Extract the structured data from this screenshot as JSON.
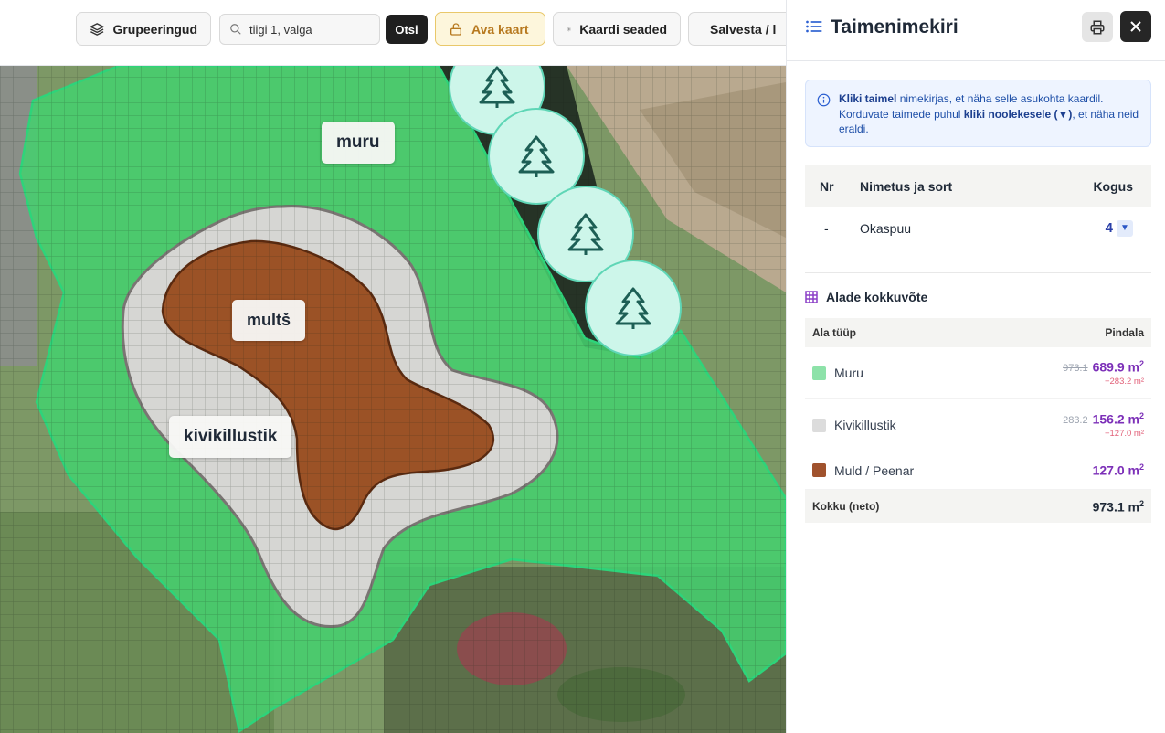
{
  "toolbar": {
    "groupings_label": "Grupeeringud",
    "search_value": "tiigi 1, valga",
    "search_button": "Otsi",
    "open_map_label": "Ava kaart",
    "map_settings_label": "Kaardi seaded",
    "save_label": "Salvesta / l"
  },
  "map": {
    "labels": {
      "lawn": "muru",
      "mulch": "multš",
      "gravel": "kivikillustik"
    },
    "tree_count": 4
  },
  "panel": {
    "title": "Taimenimekiri",
    "info": {
      "bold1": "Kliki taimel",
      "text1": " nimekirjas, et näha selle asukohta kaardil. Korduvate taimede puhul ",
      "bold2": "kliki noolekesele (▼)",
      "text2": ", et näha neid eraldi."
    },
    "plant_table": {
      "headers": {
        "nr": "Nr",
        "name": "Nimetus ja sort",
        "qty": "Kogus"
      },
      "rows": [
        {
          "nr": "-",
          "name": "Okaspuu",
          "qty": "4",
          "toggle": "▼"
        }
      ]
    },
    "areas": {
      "title": "Alade kokkuvõte",
      "headers": {
        "type": "Ala tüüp",
        "area": "Pindala"
      },
      "rows": [
        {
          "name": "Muru",
          "color": "#8de2a9",
          "old": "973.1",
          "value": "689.9 m",
          "delta": "−283.2 m²"
        },
        {
          "name": "Kivikillustik",
          "color": "#dcdcdc",
          "old": "283.2",
          "value": "156.2 m",
          "delta": "−127.0 m²"
        },
        {
          "name": "Muld / Peenar",
          "color": "#a0522d",
          "old": "",
          "value": "127.0 m",
          "delta": ""
        }
      ],
      "total_label": "Kokku (neto)",
      "total_value": "973.1 m"
    }
  },
  "colors": {
    "lawn": "#3fcf6a",
    "mulch": "#9b5226",
    "gravel": "#d9d9d6",
    "tree_marker": "#cdf6ea",
    "accent_purple": "#7c2fb8"
  }
}
